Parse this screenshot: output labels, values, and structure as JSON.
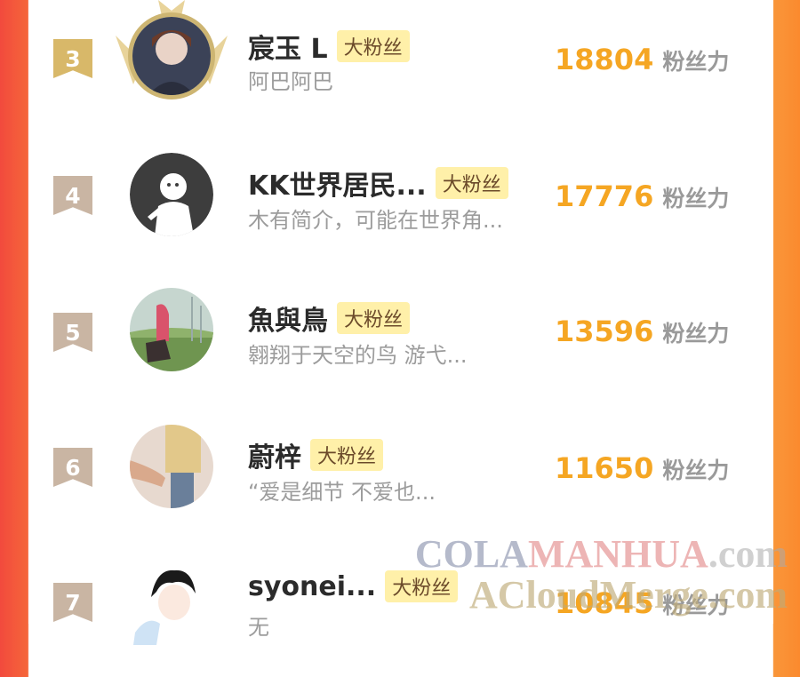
{
  "users": [
    {
      "rank": "3",
      "name": "宸玉  L",
      "badge": "大粉丝",
      "intro": "阿巴阿巴",
      "score": "18804",
      "unit": "粉丝力"
    },
    {
      "rank": "4",
      "name": "KK世界居民...",
      "badge": "大粉丝",
      "intro": "木有简介，可能在世界角...",
      "score": "17776",
      "unit": "粉丝力"
    },
    {
      "rank": "5",
      "name": "魚與鳥",
      "badge": "大粉丝",
      "intro": "翱翔于天空的鸟 游弋...",
      "score": "13596",
      "unit": "粉丝力"
    },
    {
      "rank": "6",
      "name": "蔚梓",
      "badge": "大粉丝",
      "intro": "“爱是细节 不爱也...",
      "score": "11650",
      "unit": "粉丝力"
    },
    {
      "rank": "7",
      "name": "syonei...",
      "badge": "大粉丝",
      "intro": "无",
      "score": "10845",
      "unit": "粉丝力"
    }
  ],
  "watermark": {
    "line1_a": "COLA",
    "line1_b": "MANHUA",
    "line1_c": ".com",
    "line2": "ACloudMerge.com"
  },
  "colors": {
    "score": "#f5a623",
    "badge_bg": "#fff0a9",
    "rank_gold": "#d8b869",
    "rank_grey": "#c9b5a3"
  }
}
